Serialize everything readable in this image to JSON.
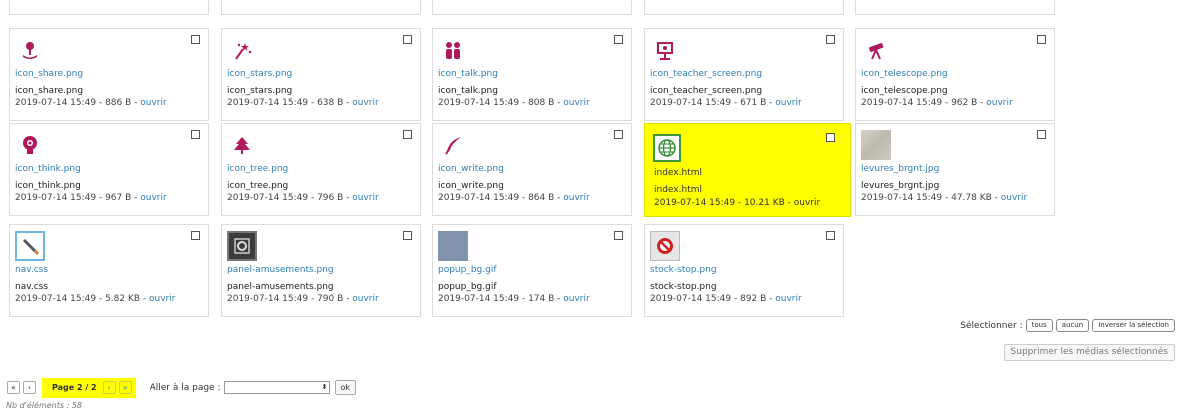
{
  "gallery": {
    "row1": [
      {
        "link": "icon_share.png",
        "file": "icon_share.png",
        "meta": "2019-07-14 15:49 - 886 B - ",
        "open": "ouvrir",
        "icon": "share-icon"
      },
      {
        "link": "icon_stars.png",
        "file": "icon_stars.png",
        "meta": "2019-07-14 15:49 - 638 B - ",
        "open": "ouvrir",
        "icon": "stars-icon"
      },
      {
        "link": "icon_talk.png",
        "file": "icon_talk.png",
        "meta": "2019-07-14 15:49 - 808 B - ",
        "open": "ouvrir",
        "icon": "talk-icon"
      },
      {
        "link": "icon_teacher_screen.png",
        "file": "icon_teacher_screen.png",
        "meta": "2019-07-14 15:49 - 671 B - ",
        "open": "ouvrir",
        "icon": "teacher-screen-icon"
      },
      {
        "link": "icon_telescope.png",
        "file": "icon_telescope.png",
        "meta": "2019-07-14 15:49 - 962 B - ",
        "open": "ouvrir",
        "icon": "telescope-icon"
      }
    ],
    "row2": [
      {
        "link": "icon_think.png",
        "file": "icon_think.png",
        "meta": "2019-07-14 15:49 - 967 B - ",
        "open": "ouvrir",
        "icon": "think-icon"
      },
      {
        "link": "icon_tree.png",
        "file": "icon_tree.png",
        "meta": "2019-07-14 15:49 - 796 B - ",
        "open": "ouvrir",
        "icon": "tree-icon"
      },
      {
        "link": "icon_write.png",
        "file": "icon_write.png",
        "meta": "2019-07-14 15:49 - 864 B - ",
        "open": "ouvrir",
        "icon": "write-icon"
      },
      {
        "link": "index.html",
        "file": "index.html",
        "meta": "2019-07-14 15:49 - 10.21 KB - ",
        "open": "ouvrir",
        "icon": "globe-icon",
        "highlighted": true
      },
      {
        "link": "levures_brgnt.jpg",
        "file": "levures_brgnt.jpg",
        "meta": "2019-07-14 15:49 - 47.78 KB - ",
        "open": "ouvrir",
        "icon": "image-thumbnail"
      }
    ],
    "row3": [
      {
        "link": "nav.css",
        "file": "nav.css",
        "meta": "2019-07-14 15:49 - 5.82 KB - ",
        "open": "ouvrir",
        "icon": "pencil-icon"
      },
      {
        "link": "panel-amusements.png",
        "file": "panel-amusements.png",
        "meta": "2019-07-14 15:49 - 790 B - ",
        "open": "ouvrir",
        "icon": "panel-icon"
      },
      {
        "link": "popup_bg.gif",
        "file": "popup_bg.gif",
        "meta": "2019-07-14 15:49 - 174 B - ",
        "open": "ouvrir",
        "icon": "image-thumbnail"
      },
      {
        "link": "stock-stop.png",
        "file": "stock-stop.png",
        "meta": "2019-07-14 15:49 - 892 B - ",
        "open": "ouvrir",
        "icon": "stop-icon"
      }
    ]
  },
  "selection": {
    "label": "Sélectionner :",
    "all": "tous",
    "none": "aucun",
    "invert": "Inverser la sélection",
    "delete": "Supprimer les médias sélectionnés"
  },
  "pagination": {
    "first": "«",
    "prev": "‹",
    "page": "Page 2 / 2",
    "next": "›",
    "last": "»",
    "goto_label": "Aller à la page :",
    "goto_value": "",
    "ok": "ok",
    "count": "Nb d'éléments : 58"
  },
  "colors": {
    "accent_pink": "#b0195e",
    "link_blue": "#2d7fb8",
    "highlight": "#ffff00"
  }
}
